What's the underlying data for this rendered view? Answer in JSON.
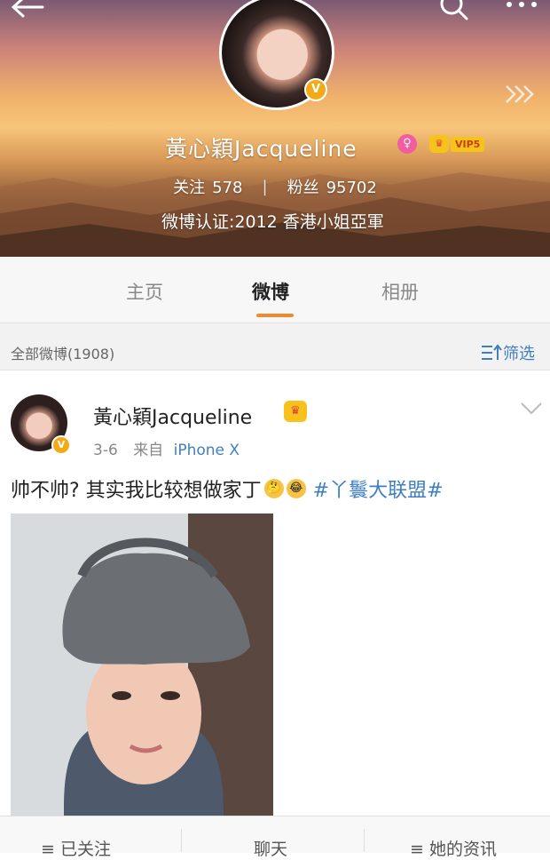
{
  "profile": {
    "name": "黃心穎Jacqueline",
    "vip_label": "VIP5",
    "following_label": "关注",
    "following_count": "578",
    "followers_label": "粉丝",
    "followers_count": "95702",
    "verification": "微博认证:2012 香港小姐亞軍"
  },
  "tabs": [
    {
      "label": "主页",
      "active": false
    },
    {
      "label": "微博",
      "active": true
    },
    {
      "label": "相册",
      "active": false
    }
  ],
  "filter": {
    "title": "全部微博(1908)",
    "button_label": "筛选"
  },
  "post": {
    "author": "黃心穎Jacqueline",
    "date": "3-6",
    "source_prefix": "来自",
    "source": "iPhone X",
    "text": "帅不帅? 其实我比较想做家丁",
    "topic": "#丫鬟大联盟#"
  },
  "bottom_bar": {
    "follow_label": "已关注",
    "chat_label": "聊天",
    "more_label": "她的资讯"
  },
  "colors": {
    "accent_orange": "#f08a2d",
    "link_blue": "#3f7fc1",
    "verified_badge": "#f4a916"
  }
}
